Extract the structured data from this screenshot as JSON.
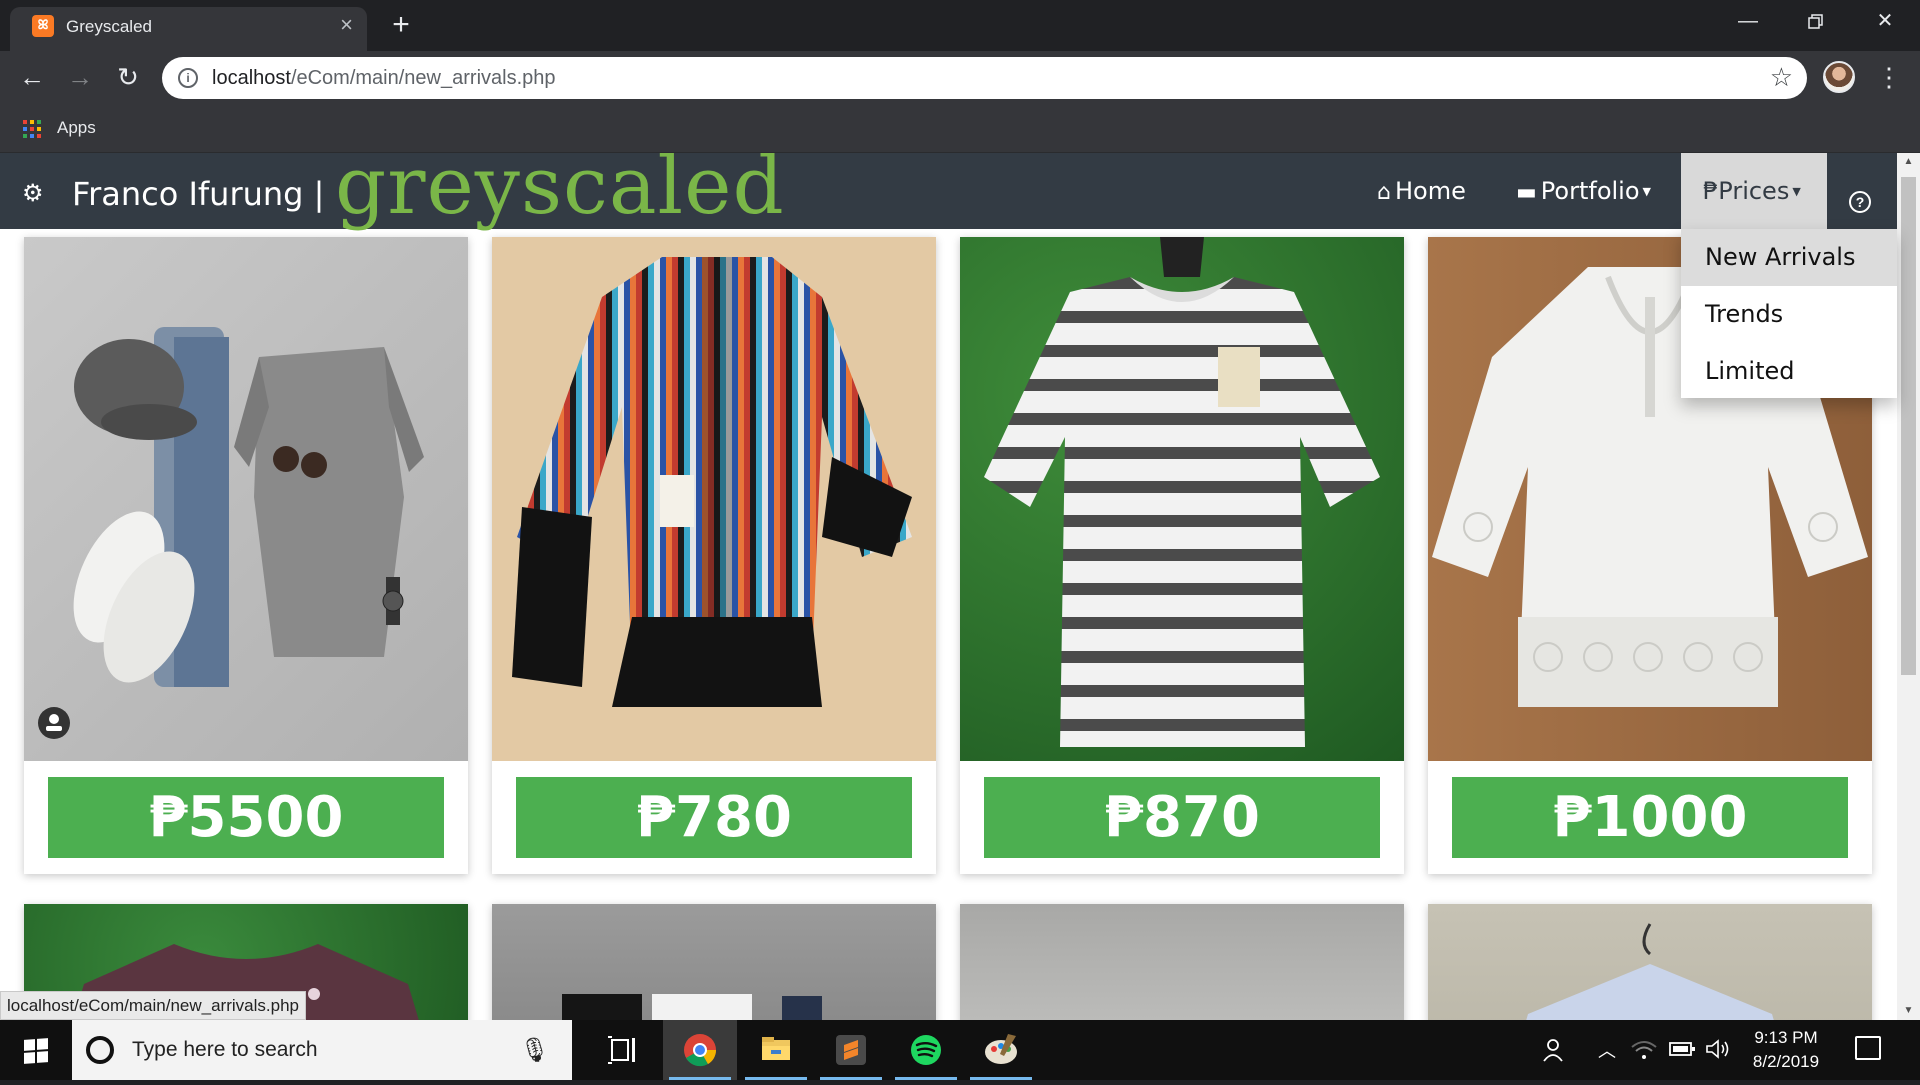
{
  "browser": {
    "tab_title": "Greyscaled",
    "tab_favicon": "xampp-icon",
    "url_host": "localhost",
    "url_path": "/eCom/main/new_arrivals.php",
    "bookmarks_apps_label": "Apps",
    "status_url": "localhost/eCom/main/new_arrivals.php"
  },
  "site": {
    "brand_name": "Franco Ifurung",
    "brand_sep": "|",
    "logo_text": "greyscaled",
    "nav": {
      "home": "Home",
      "portfolio": "Portfolio",
      "prices": "₱Prices"
    },
    "dropdown": [
      "New Arrivals",
      "Trends",
      "Limited"
    ],
    "colors": {
      "navbar": "#333b44",
      "logo": "#7ab648",
      "price_button": "#4caf50"
    }
  },
  "products": [
    {
      "price": "₱5500",
      "photo": "outfit-flatlay-grey-sweater-jeans-cap"
    },
    {
      "price": "₱780",
      "photo": "striped-tribal-cardigan-with-fringe"
    },
    {
      "price": "₱870",
      "photo": "grey-white-striped-tee-on-grass"
    },
    {
      "price": "₱1000",
      "photo": "white-lace-crochet-blouse"
    }
  ],
  "taskbar": {
    "search_placeholder": "Type here to search",
    "time": "9:13 PM",
    "date": "8/2/2019"
  }
}
